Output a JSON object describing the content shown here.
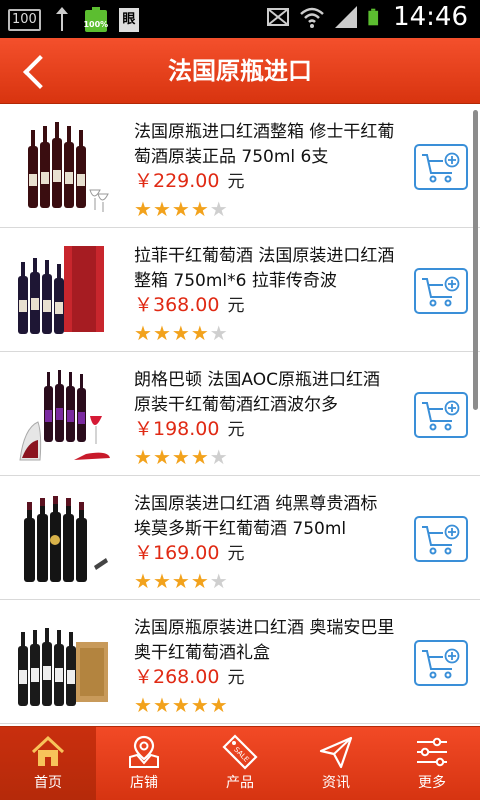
{
  "status_bar": {
    "left_box": "100",
    "battery_small": "100%",
    "doc_glyph": "眼",
    "time": "14:46",
    "icons": [
      "usb-icon",
      "battery-icon",
      "mute-icon",
      "wifi-icon",
      "signal-icon",
      "battery-icon"
    ]
  },
  "header": {
    "title": "法国原瓶进口",
    "back_icon": "chevron-left-icon"
  },
  "products": [
    {
      "name": "法国原瓶进口红酒整箱 修士干红葡萄酒原装正品 750ml 6支",
      "price": "￥229.00",
      "unit": "元",
      "rating": 4
    },
    {
      "name": "拉菲干红葡萄酒 法国原装进口红酒整箱 750ml*6 拉菲传奇波",
      "price": "￥368.00",
      "unit": "元",
      "rating": 4
    },
    {
      "name": "朗格巴顿 法国AOC原瓶进口红酒 原装干红葡萄酒红酒波尔多",
      "price": "￥198.00",
      "unit": "元",
      "rating": 4
    },
    {
      "name": "法国原装进口红酒 纯黑尊贵酒标 埃莫多斯干红葡萄酒 750ml",
      "price": "￥169.00",
      "unit": "元",
      "rating": 4
    },
    {
      "name": "法国原瓶原装进口红酒 奥瑞安巴里奥干红葡萄酒礼盒",
      "price": "￥268.00",
      "unit": "元",
      "rating": 5
    }
  ],
  "colors": {
    "accent": "#e03a16",
    "price": "#e02a14",
    "cart_border": "#3a8fd8",
    "star": "#f2a21c"
  },
  "nav": [
    {
      "label": "首页",
      "icon": "home-icon",
      "active": true
    },
    {
      "label": "店铺",
      "icon": "store-map-icon",
      "active": false
    },
    {
      "label": "产品",
      "icon": "sale-tag-icon",
      "active": false
    },
    {
      "label": "资讯",
      "icon": "send-icon",
      "active": false
    },
    {
      "label": "更多",
      "icon": "sliders-icon",
      "active": false
    }
  ]
}
